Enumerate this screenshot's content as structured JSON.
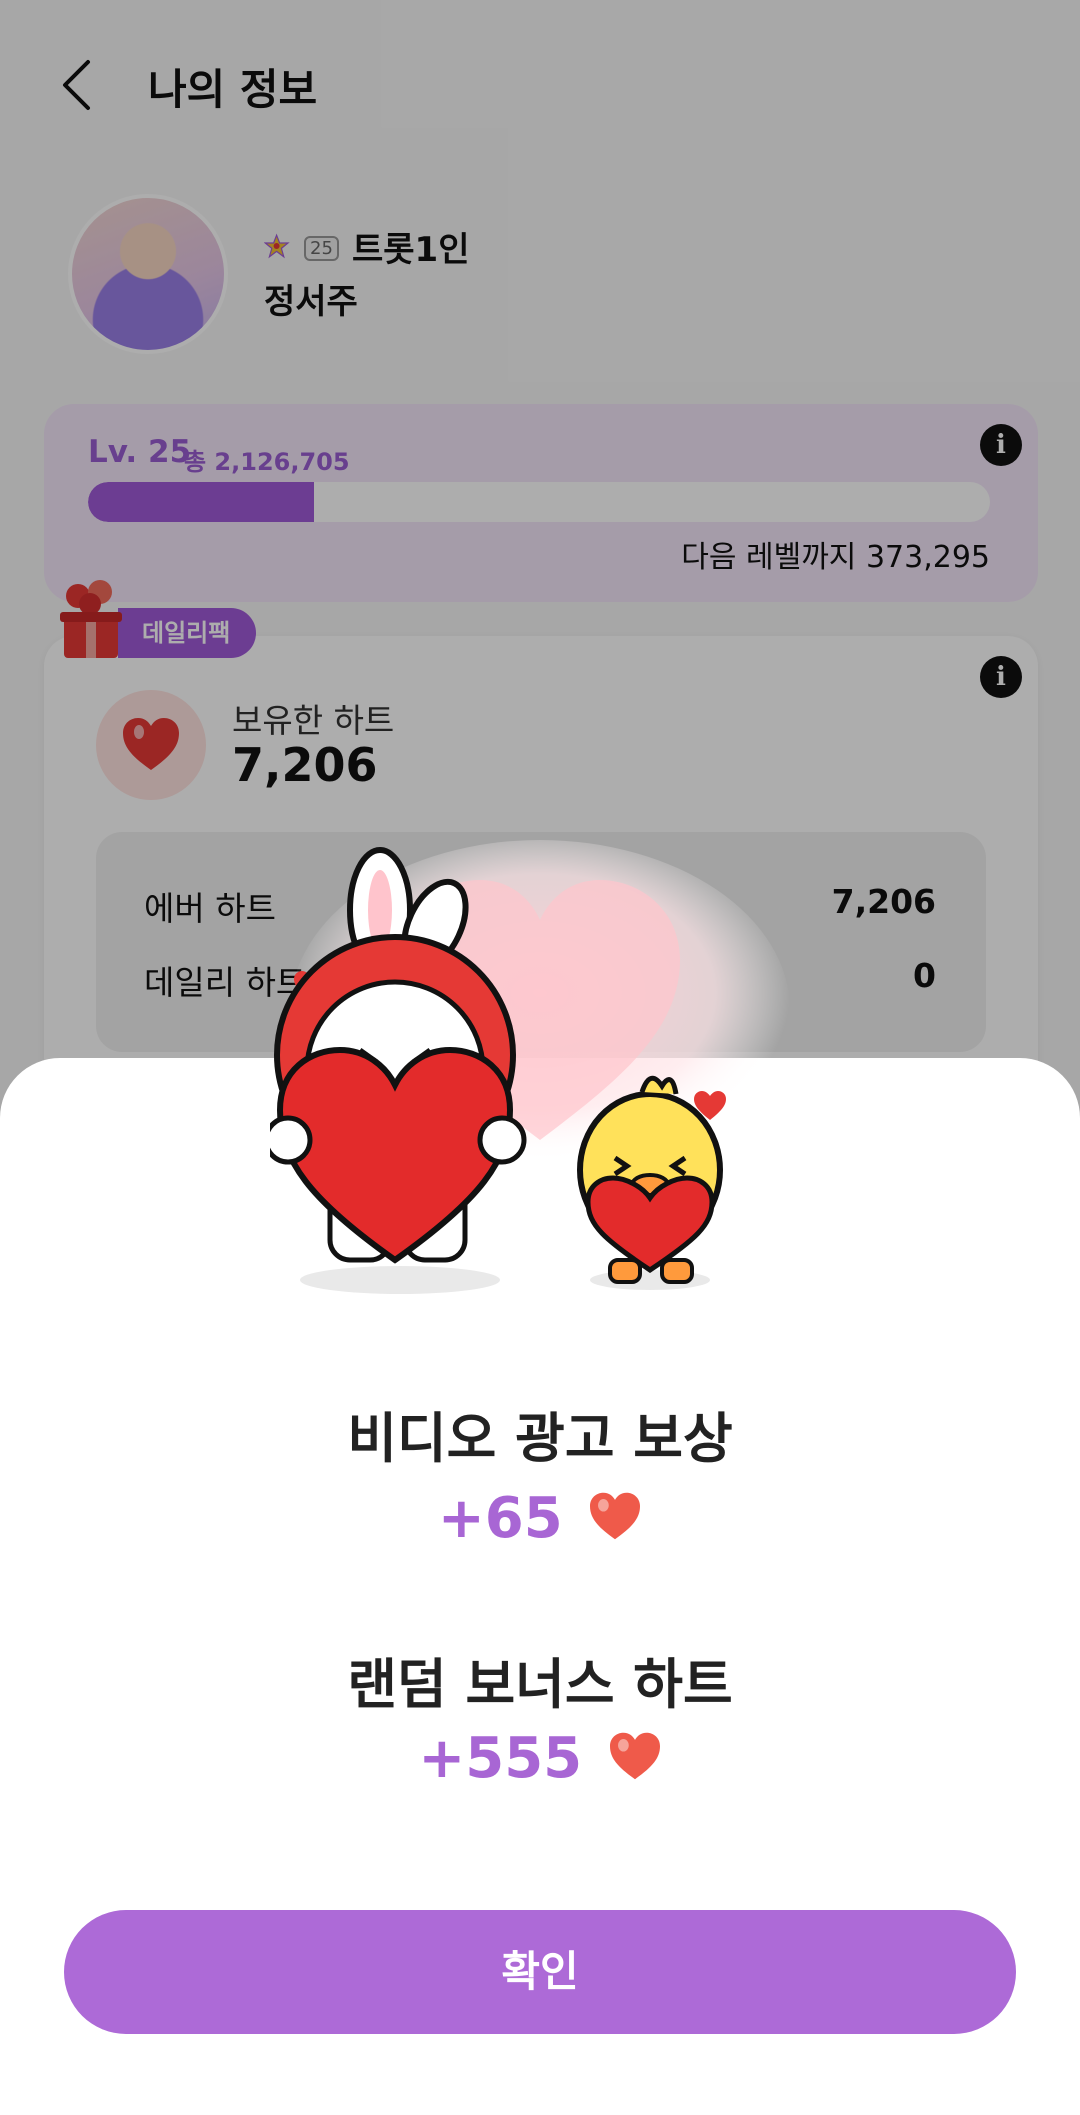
{
  "header": {
    "title": "나의 정보"
  },
  "profile": {
    "rank_level": "25",
    "group": "트롯1인",
    "name": "정서주"
  },
  "level": {
    "label": "Lv. 25",
    "total": "총 2,126,705",
    "progress_percent": 25,
    "next": "다음 레벨까지 373,295"
  },
  "daily_tag": "데일리팩",
  "hearts": {
    "label": "보유한 하트",
    "value": "7,206",
    "rows": [
      {
        "label": "에버 하트",
        "value": "7,206"
      },
      {
        "label": "데일리 하트",
        "value": "0"
      }
    ]
  },
  "reward": {
    "title1": "비디오 광고 보상",
    "amount1": "+65",
    "title2": "랜덤 보너스 하트",
    "amount2": "+555",
    "confirm": "확인"
  },
  "colors": {
    "accent": "#a05ad8",
    "button": "#ad6ad7",
    "heart": "#e53935"
  }
}
